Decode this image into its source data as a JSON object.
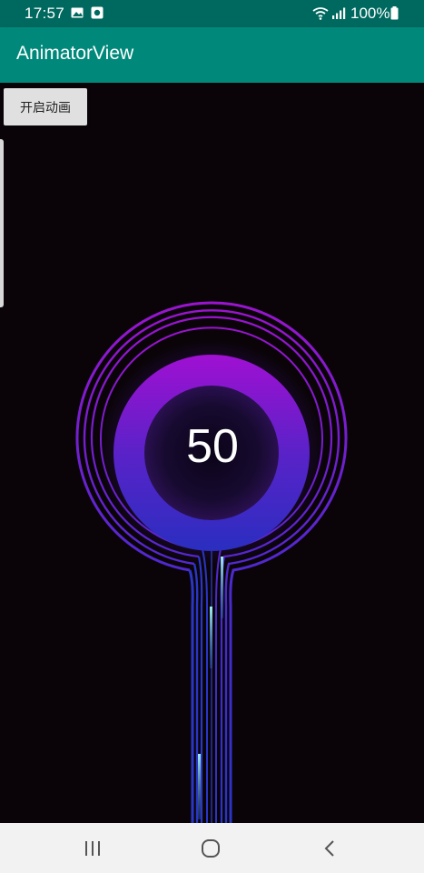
{
  "status_bar": {
    "time": "17:57",
    "battery_text": "100%",
    "icons": [
      "gallery-icon",
      "photo-icon",
      "wifi-icon",
      "signal-icon",
      "battery-icon"
    ]
  },
  "app_bar": {
    "title": "AnimatorView",
    "color": "#00897b"
  },
  "main": {
    "start_button_label": "开启动画",
    "gauge_value": "50",
    "gauge_colors": {
      "top": "#a012d0",
      "bottom": "#2a2ec0",
      "ring": "#8a1fd4",
      "pipe": "#2838c8",
      "sparkle": "#7ad8e0"
    }
  },
  "nav_bar": {
    "icons": [
      "recents-icon",
      "home-icon",
      "back-icon"
    ]
  }
}
